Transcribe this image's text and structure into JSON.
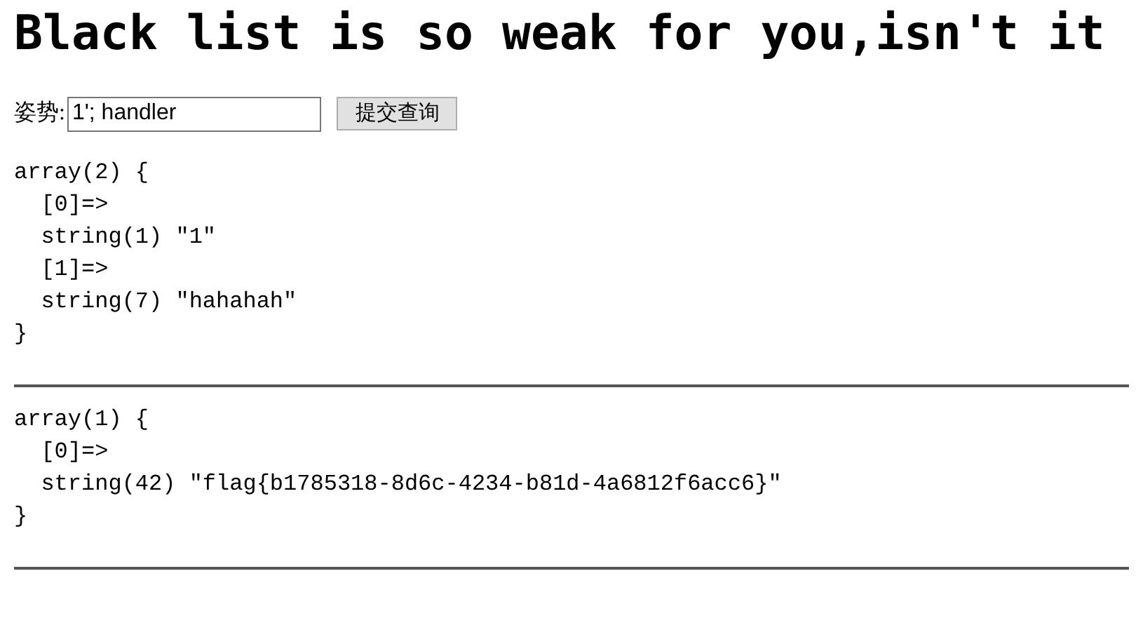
{
  "heading": "Black list is so weak for you,isn't it",
  "form": {
    "label": "姿势:",
    "value": "1'; handler",
    "button": "提交查询"
  },
  "dumps": [
    {
      "text": "array(2) {\n  [0]=>\n  string(1) \"1\"\n  [1]=>\n  string(7) \"hahahah\"\n}"
    },
    {
      "text": "array(1) {\n  [0]=>\n  string(42) \"flag{b1785318-8d6c-4234-b81d-4a6812f6acc6}\"\n}"
    }
  ]
}
